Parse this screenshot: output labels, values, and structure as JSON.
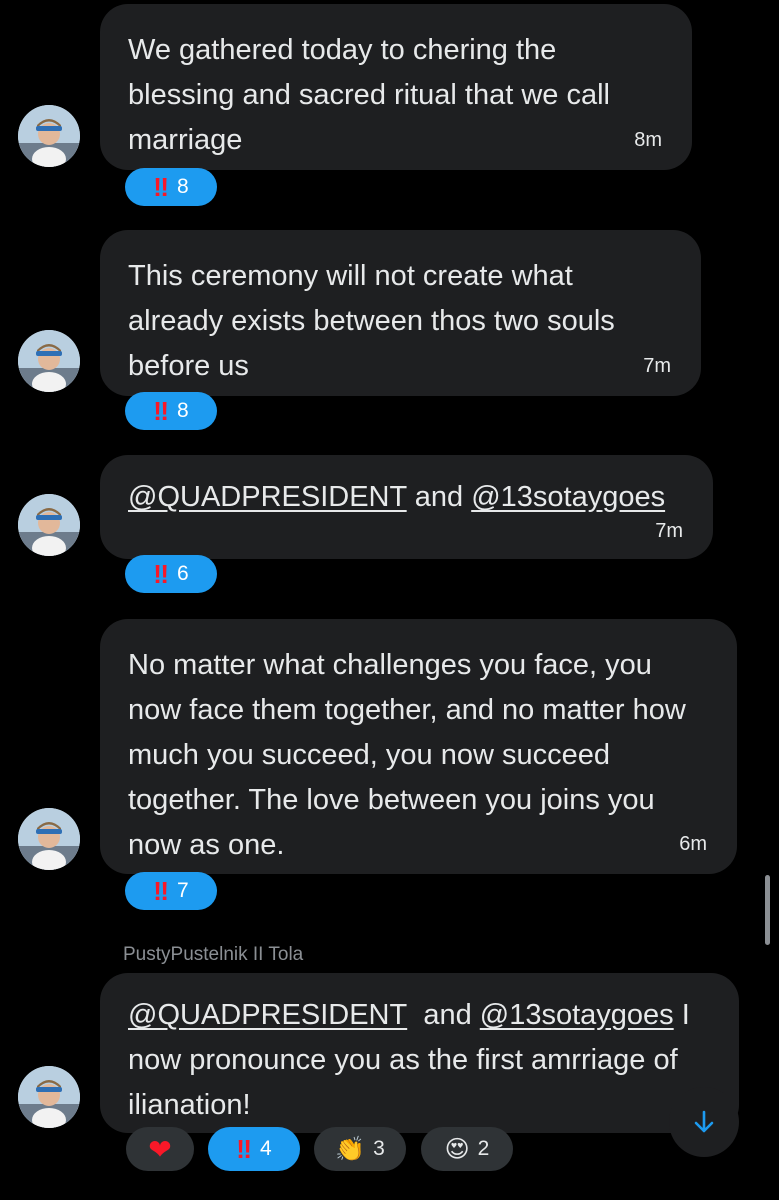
{
  "messages": [
    {
      "text": "We gathered today to chering the blessing and sacred ritual that we call marriage",
      "time": "8m",
      "reaction": {
        "icon": "double-exclamation",
        "glyph": "‼",
        "count": "8"
      }
    },
    {
      "text": "This ceremony will not create what already exists between thos two souls before us",
      "time": "7m",
      "reaction": {
        "icon": "double-exclamation",
        "glyph": "‼",
        "count": "8"
      }
    },
    {
      "mention1": "@QUADPRESIDENT",
      "and": "and",
      "mention2": "@13sotaygoes",
      "time": "7m",
      "reaction": {
        "icon": "double-exclamation",
        "glyph": "‼",
        "count": "6"
      }
    },
    {
      "text": "No matter what challenges you face, you now face them together, and no matter how much you succeed, you now succeed together. The love between you joins you now as one.",
      "time": "6m",
      "reaction": {
        "icon": "double-exclamation",
        "glyph": "‼",
        "count": "7"
      }
    },
    {
      "sender": "PustyPustelnik II Tola",
      "mention1": "@QUADPRESIDENT",
      "and": "and",
      "mention2": "@13sotaygoes",
      "rest": " I now pronounce you as the first amrriage of ilianation!",
      "reactions": [
        {
          "icon": "heart",
          "glyph": "❤",
          "count": ""
        },
        {
          "icon": "double-exclamation",
          "glyph": "‼",
          "count": "4"
        },
        {
          "icon": "clapping-hands",
          "glyph": "👏",
          "count": "3"
        },
        {
          "icon": "heart-eyes",
          "glyph": "😍",
          "count": "2"
        }
      ]
    }
  ],
  "colors": {
    "background": "#000000",
    "bubble": "#1e1f21",
    "accent": "#1d9bf0",
    "text": "#e7e9ea",
    "muted": "#8b8f94"
  },
  "icons": {
    "scroll_down": "arrow-down-icon"
  }
}
